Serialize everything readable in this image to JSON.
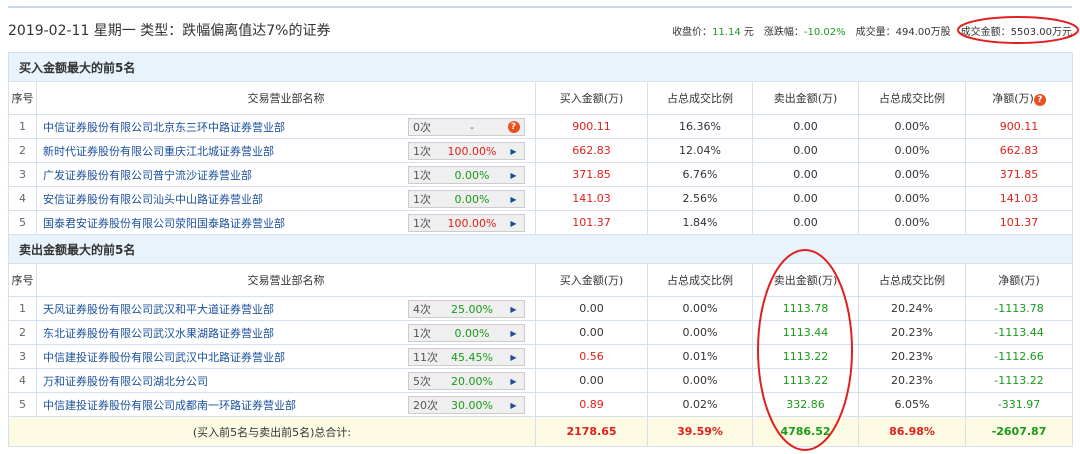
{
  "header": {
    "date": "2019-02-11 星期一",
    "type": "类型：跌幅偏离值达7%的证券",
    "close_label": "收盘价：",
    "close": "11.14",
    "close_unit": " 元",
    "change_label": "涨跌幅：",
    "change": "-10.02%",
    "volume_label": "成交量：",
    "volume": "494.00万股",
    "amount_label": "成交金额：",
    "amount": "5503.00万元"
  },
  "columns": [
    "序号",
    "交易营业部名称",
    "买入金额(万)",
    "占总成交比例",
    "卖出金额(万)",
    "占总成交比例",
    "净额(万)"
  ],
  "buy": {
    "title": "买入金额最大的前5名",
    "rows": [
      {
        "no": "1",
        "name": "中信证券股份有限公司北京东三环中路证券营业部",
        "count": "0次",
        "pct": "-",
        "buy": "900.11",
        "buy_ratio": "16.36%",
        "sell": "0.00",
        "sell_ratio": "0.00%",
        "net": "900.11"
      },
      {
        "no": "2",
        "name": "新时代证券股份有限公司重庆江北城证券营业部",
        "count": "1次",
        "pct": "100.00%",
        "buy": "662.83",
        "buy_ratio": "12.04%",
        "sell": "0.00",
        "sell_ratio": "0.00%",
        "net": "662.83"
      },
      {
        "no": "3",
        "name": "广发证券股份有限公司普宁流沙证券营业部",
        "count": "1次",
        "pct": "0.00%",
        "buy": "371.85",
        "buy_ratio": "6.76%",
        "sell": "0.00",
        "sell_ratio": "0.00%",
        "net": "371.85"
      },
      {
        "no": "4",
        "name": "安信证券股份有限公司汕头中山路证券营业部",
        "count": "1次",
        "pct": "0.00%",
        "buy": "141.03",
        "buy_ratio": "2.56%",
        "sell": "0.00",
        "sell_ratio": "0.00%",
        "net": "141.03"
      },
      {
        "no": "5",
        "name": "国泰君安证券股份有限公司荥阳国泰路证券营业部",
        "count": "1次",
        "pct": "100.00%",
        "buy": "101.37",
        "buy_ratio": "1.84%",
        "sell": "0.00",
        "sell_ratio": "0.00%",
        "net": "101.37"
      }
    ]
  },
  "sell": {
    "title": "卖出金额最大的前5名",
    "rows": [
      {
        "no": "1",
        "name": "天风证券股份有限公司武汉和平大道证券营业部",
        "count": "4次",
        "pct": "25.00%",
        "buy": "0.00",
        "buy_ratio": "0.00%",
        "sell": "1113.78",
        "sell_ratio": "20.24%",
        "net": "-1113.78"
      },
      {
        "no": "2",
        "name": "东北证券股份有限公司武汉水果湖路证券营业部",
        "count": "1次",
        "pct": "0.00%",
        "buy": "0.00",
        "buy_ratio": "0.00%",
        "sell": "1113.44",
        "sell_ratio": "20.23%",
        "net": "-1113.44"
      },
      {
        "no": "3",
        "name": "中信建投证券股份有限公司武汉中北路证券营业部",
        "count": "11次",
        "pct": "45.45%",
        "buy": "0.56",
        "buy_ratio": "0.01%",
        "sell": "1113.22",
        "sell_ratio": "20.23%",
        "net": "-1112.66"
      },
      {
        "no": "4",
        "name": "万和证券股份有限公司湖北分公司",
        "count": "5次",
        "pct": "20.00%",
        "buy": "0.00",
        "buy_ratio": "0.00%",
        "sell": "1113.22",
        "sell_ratio": "20.23%",
        "net": "-1113.22"
      },
      {
        "no": "5",
        "name": "中信建投证券股份有限公司成都南一环路证券营业部",
        "count": "20次",
        "pct": "30.00%",
        "buy": "0.89",
        "buy_ratio": "0.02%",
        "sell": "332.86",
        "sell_ratio": "6.05%",
        "net": "-331.97"
      }
    ]
  },
  "total": {
    "label": "(买入前5名与卖出前5名)总合计:",
    "buy": "2178.65",
    "buy_ratio": "39.59%",
    "sell": "4786.52",
    "sell_ratio": "86.98%",
    "net": "-2607.87"
  }
}
